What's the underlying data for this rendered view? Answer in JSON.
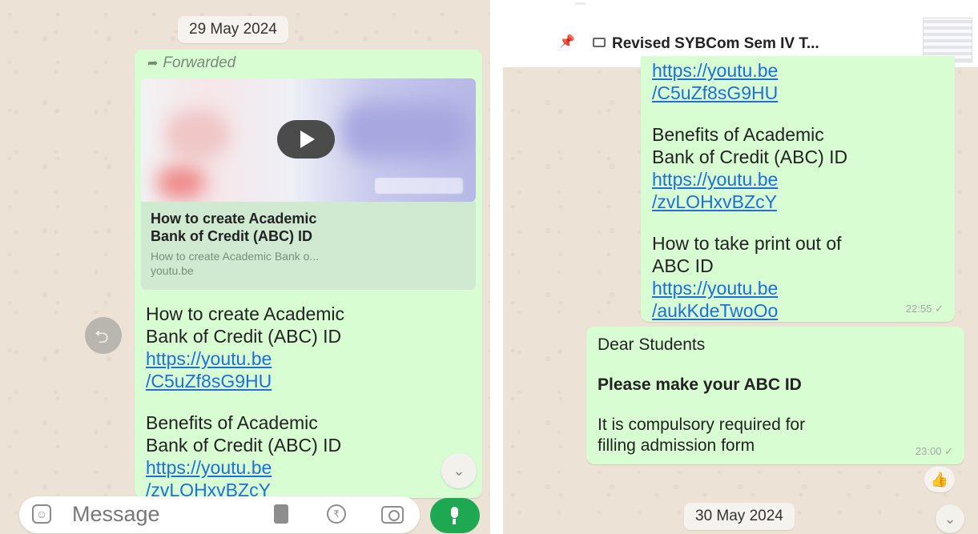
{
  "left": {
    "date_chip": "29 May 2024",
    "forwarded_label": "Forwarded",
    "link_preview": {
      "title_line1": "How to create Academic",
      "title_line2": "Bank of Credit (ABC) ID",
      "description": "How to create Academic Bank o...",
      "domain": "youtu.be"
    },
    "message": {
      "p1_line1": "How to create Academic",
      "p1_line2": "Bank of Credit (ABC) ID",
      "p1_link1": "https://youtu.be",
      "p1_link2": "/C5uZf8sG9HU",
      "p2_line1": "Benefits of Academic",
      "p2_line2": "Bank of Credit (ABC) ID",
      "p2_link1": "https://youtu.be",
      "p2_link2": "/zvLOHxvBZcY"
    },
    "input": {
      "placeholder": "Message"
    }
  },
  "right": {
    "pinned": {
      "title": "Revised SYBCom Sem IV T..."
    },
    "message1": {
      "link_a1": "https://youtu.be",
      "link_a2": "/C5uZf8sG9HU",
      "p2_line1": "Benefits of Academic",
      "p2_line2": "Bank of Credit (ABC) ID",
      "p2_link1": "https://youtu.be",
      "p2_link2": "/zvLOHxvBZcY",
      "p3_line1": "How to take print out of",
      "p3_line2": "ABC ID",
      "p3_link1": "https://youtu.be",
      "p3_link2": "/aukKdeTwoOo",
      "time": "22:55"
    },
    "message2": {
      "greeting": "Dear Students",
      "bold_line": "Please make your ABC ID",
      "body_line1": "It is compulsory required for",
      "body_line2": "filling admission form",
      "time": "23:00"
    },
    "reaction": "👍",
    "date_chip_bottom": "30 May 2024"
  },
  "colors": {
    "bubble_out": "#d9fdd3",
    "link": "#1e6fd8",
    "mic_button": "#1da851",
    "chat_bg": "#ece3d6"
  }
}
